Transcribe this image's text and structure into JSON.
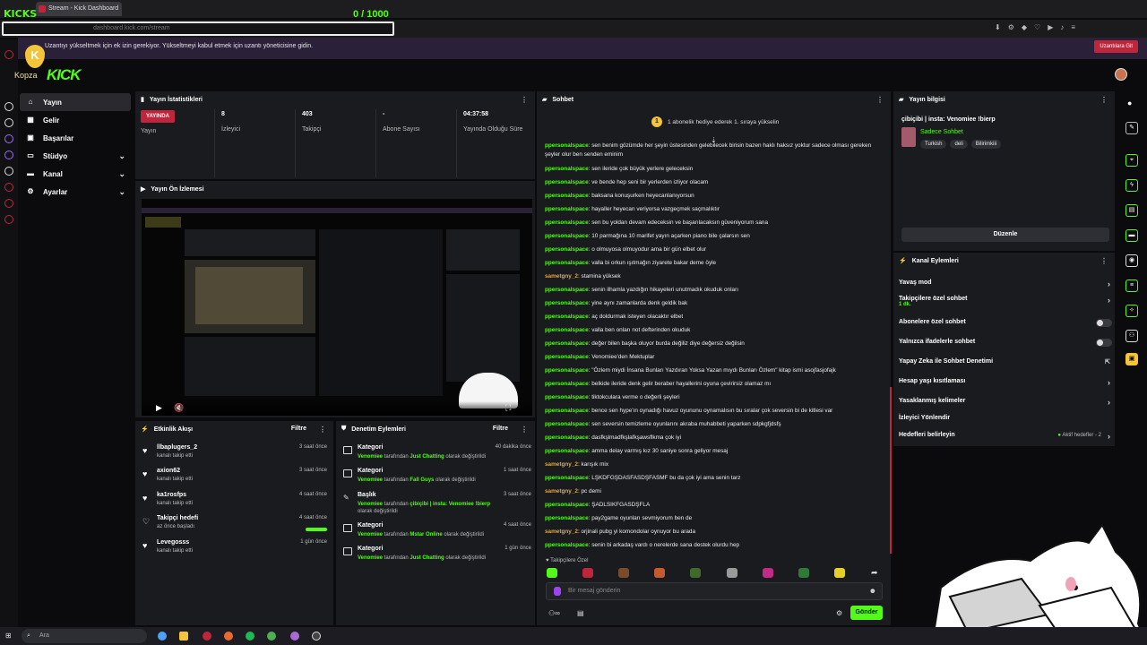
{
  "browser": {
    "tab_title": "Stream - Kick Dashboard",
    "url": "dashboard.kick.com/stream",
    "overlay_kicks": "KICKS",
    "overlay_counter": "0 / 1000"
  },
  "notification": {
    "text": "Uzantıyı yükseltmek için ek izin gerekiyor. Yükseltmeyi kabul etmek için uzantı yöneticisine gidin.",
    "button": "Uzantılara Git"
  },
  "brand": {
    "logo": "KICK",
    "kopza": "Kopza",
    "kopza_letter": "K"
  },
  "nav": {
    "items": [
      {
        "label": "Yayın",
        "icon": "home-icon"
      },
      {
        "label": "Gelir",
        "icon": "grid-icon"
      },
      {
        "label": "Başarılar",
        "icon": "trophy-icon"
      },
      {
        "label": "Stüdyo",
        "icon": "display-icon"
      },
      {
        "label": "Kanal",
        "icon": "monitor-icon"
      },
      {
        "label": "Ayarlar",
        "icon": "gear-icon"
      }
    ]
  },
  "stats": {
    "title": "Yayın İstatistikleri",
    "live_badge": "YAYINDA",
    "live_label": "Yayın",
    "viewers": "8",
    "viewers_label": "İzleyici",
    "followers": "403",
    "followers_label": "Takipçi",
    "subs": "-",
    "subs_label": "Abone Sayısı",
    "duration": "04:37:58",
    "duration_label": "Yayında Olduğu Süre"
  },
  "preview": {
    "title": "Yayın Ön İzlemesi"
  },
  "activity": {
    "title": "Etkinlik Akışı",
    "filter": "Filtre",
    "items": [
      {
        "name": "llbaplugers_2",
        "sub": "kanalı takip etti",
        "time": "3 saat önce"
      },
      {
        "name": "axion62",
        "sub": "kanalı takip etti",
        "time": "3 saat önce"
      },
      {
        "name": "ka1rosfps",
        "sub": "kanalı takip etti",
        "time": "4 saat önce"
      },
      {
        "name": "Takipçi hedefi",
        "sub": "az önce başladı",
        "time": "4 saat önce"
      },
      {
        "name": "Levegosss",
        "sub": "kanalı takip etti",
        "time": "1 gün önce"
      }
    ]
  },
  "moderation": {
    "title": "Denetim Eylemleri",
    "filter": "Filtre",
    "items": [
      {
        "name": "Kategori",
        "user": "Venomiee",
        "mid": " tarafından ",
        "target": "Just Chatting",
        "end": " olarak değiştirildi",
        "time": "40 dakika önce"
      },
      {
        "name": "Kategori",
        "user": "Venomiee",
        "mid": " tarafından ",
        "target": "Fall Guys",
        "end": " olarak değiştirildi",
        "time": "1 saat önce"
      },
      {
        "name": "Başlık",
        "user": "Venomiee",
        "mid": " tarafından ",
        "target": "çibiçibi | insta: Venomiee !bierp",
        "end": " olarak değiştirildi",
        "time": "3 saat önce"
      },
      {
        "name": "Kategori",
        "user": "Venomiee",
        "mid": " tarafından ",
        "target": "Mstar Online",
        "end": " olarak değiştirildi",
        "time": "4 saat önce"
      },
      {
        "name": "Kategori",
        "user": "Venomiee",
        "mid": " tarafından ",
        "target": "Just Chatting",
        "end": " olarak değiştirildi",
        "time": "1 gün önce"
      }
    ]
  },
  "chat": {
    "title": "Sohbet",
    "pinned": "1 abonelik hediye ederek 1. sıraya yükselin",
    "pinned_rank": "1",
    "followers_only": "Takipçilere Özel",
    "input_placeholder": "Bir mesaj gönderin",
    "send": "Gönder",
    "messages": [
      {
        "user": "ppersonalspace",
        "text": ": sen benim gözümde her şeyin üstesinden gelebilecek birisin bazen haklı haksız yoktur sadece olması gereken şeyler olur ben senden eminim",
        "color": "#53fc18",
        "two": true
      },
      {
        "user": "ppersonalspace",
        "text": ": sen ileride çok büyük yerlere geleceksin",
        "color": "#53fc18"
      },
      {
        "user": "ppersonalspace",
        "text": ": ve bende hep seni bir yerlerden izliyor olacam",
        "color": "#53fc18"
      },
      {
        "user": "ppersonalspace",
        "text": ": baksana konuşurken heyecanlanıyorsun",
        "color": "#53fc18"
      },
      {
        "user": "ppersonalspace",
        "text": ": hayaller heyecan veriyorsa vazgeçmek saçmalıktır",
        "color": "#53fc18"
      },
      {
        "user": "ppersonalspace",
        "text": ": sen bu yoldan devam edeceksin ve başarılacaksın güveniyorum sana",
        "color": "#53fc18"
      },
      {
        "user": "ppersonalspace",
        "text": ": 10 parmağına 10 marifet yayın açarken piano bile çalarsın sen",
        "color": "#53fc18"
      },
      {
        "user": "ppersonalspace",
        "text": ": o olmuyosa olmuyodur ama bir gün elbet olur",
        "color": "#53fc18"
      },
      {
        "user": "ppersonalspace",
        "text": ": valla bi orkun ışıtmağın ziyarete bakar deme öyle",
        "color": "#53fc18"
      },
      {
        "user": "sametgny_2",
        "text": ": stamina yüksek",
        "color": "#e2a93b"
      },
      {
        "user": "ppersonalspace",
        "text": ": senin ilhamla yazdığın hikayeleri unutmadık okuduk onları",
        "color": "#53fc18"
      },
      {
        "user": "ppersonalspace",
        "text": ": yine aynı zamanlarda denk geldik bak",
        "color": "#53fc18"
      },
      {
        "user": "ppersonalspace",
        "text": ": aç doldurmak isteyen olacaktır elbet",
        "color": "#53fc18"
      },
      {
        "user": "ppersonalspace",
        "text": ": valla ben onları not defterinden okuduk",
        "color": "#53fc18"
      },
      {
        "user": "ppersonalspace",
        "text": ": değer bilen başka oluyor burda değiliz diye değersiz değilsin",
        "color": "#53fc18"
      },
      {
        "user": "ppersonalspace",
        "text": ": Venomiee'den Mektuplar",
        "color": "#53fc18"
      },
      {
        "user": "ppersonalspace",
        "text": ": \"Özlem miydi İnsana Bunları Yazdıran Yoksa Yazan mıydı Bunları Özlem\" kitap ismi asojfasjofajk",
        "color": "#53fc18"
      },
      {
        "user": "ppersonalspace",
        "text": ": belkide ileride denk gelir beraber hayallerini oyuna çevirirsiz olamaz mı",
        "color": "#53fc18"
      },
      {
        "user": "ppersonalspace",
        "text": ": tiktokculara verme o değerli şeyleri",
        "color": "#53fc18"
      },
      {
        "user": "ppersonalspace",
        "text": ": bence sen hype'ın oynadığı havuz oyununu oynamalısın bu sıralar çok seversin bi de kitlesi var",
        "color": "#53fc18"
      },
      {
        "user": "ppersonalspace",
        "text": ": sen seversin temizleme oyunlarını akraba muhabbeti yaparken sdpkgfjdsfş",
        "color": "#53fc18"
      },
      {
        "user": "ppersonalspace",
        "text": ": dasfkşlmadfkşlafkşawsflkma çok iyi",
        "color": "#53fc18"
      },
      {
        "user": "ppersonalspace",
        "text": ": amma delay varmış kız 30 saniye sonra geliyor mesaj",
        "color": "#53fc18"
      },
      {
        "user": "sametgny_2",
        "text": ": karışık mix",
        "color": "#e2a93b"
      },
      {
        "user": "ppersonalspace",
        "text": ": LŞKDFGŞDASFASDŞFASMF bu da çok iyi ama senin tarz",
        "color": "#53fc18"
      },
      {
        "user": "sametgny_2",
        "text": ": pc demi",
        "color": "#e2a93b"
      },
      {
        "user": "ppersonalspace",
        "text": ": ŞADLSIKFGASDŞFLA",
        "color": "#53fc18"
      },
      {
        "user": "ppersonalspace",
        "text": ": pay2game oyunları sevmiyorum ben de",
        "color": "#53fc18"
      },
      {
        "user": "sametgny_2",
        "text": ": orjinali pubg yi komondolar oynuyor bu arada",
        "color": "#e2a93b"
      },
      {
        "user": "ppersonalspace",
        "text": ": senin bi arkadaş vardı o nerelerde sana destek olurdu hep",
        "color": "#53fc18"
      }
    ]
  },
  "stream_info": {
    "title": "Yayın bilgisi",
    "stream_title": "çibiçibi | insta: Venomiee !bierp",
    "category": "Sadece Sohbet",
    "tags": [
      "Turkish",
      "deli",
      "Bilirimkiii"
    ],
    "edit": "Düzenle"
  },
  "channel_actions": {
    "title": "Kanal Eylemleri",
    "rows": [
      {
        "label": "Yavaş mod",
        "kind": "arrow"
      },
      {
        "label": "Takipçilere özel sohbet",
        "sub": "1 dk.",
        "kind": "arrow"
      },
      {
        "label": "Abonelere özel sohbet",
        "kind": "toggle"
      },
      {
        "label": "Yalnızca ifadelerle sohbet",
        "kind": "toggle"
      },
      {
        "label": "Yapay Zeka ile Sohbet Denetimi",
        "kind": "ext"
      },
      {
        "label": "Hesap yaşı kısıtlaması",
        "kind": "arrow"
      },
      {
        "label": "Yasaklanmış kelimeler",
        "kind": "arrow"
      },
      {
        "label": "İzleyici Yönlendir",
        "kind": "none"
      },
      {
        "label": "Hedefleri belirleyin",
        "kind": "goal",
        "extra": "Aktif hedefler - 2"
      }
    ]
  },
  "taskbar": {
    "search": "Ara"
  },
  "colors": {
    "brand": "#53fc18",
    "live": "#c0263b",
    "panel": "#191b1f"
  }
}
